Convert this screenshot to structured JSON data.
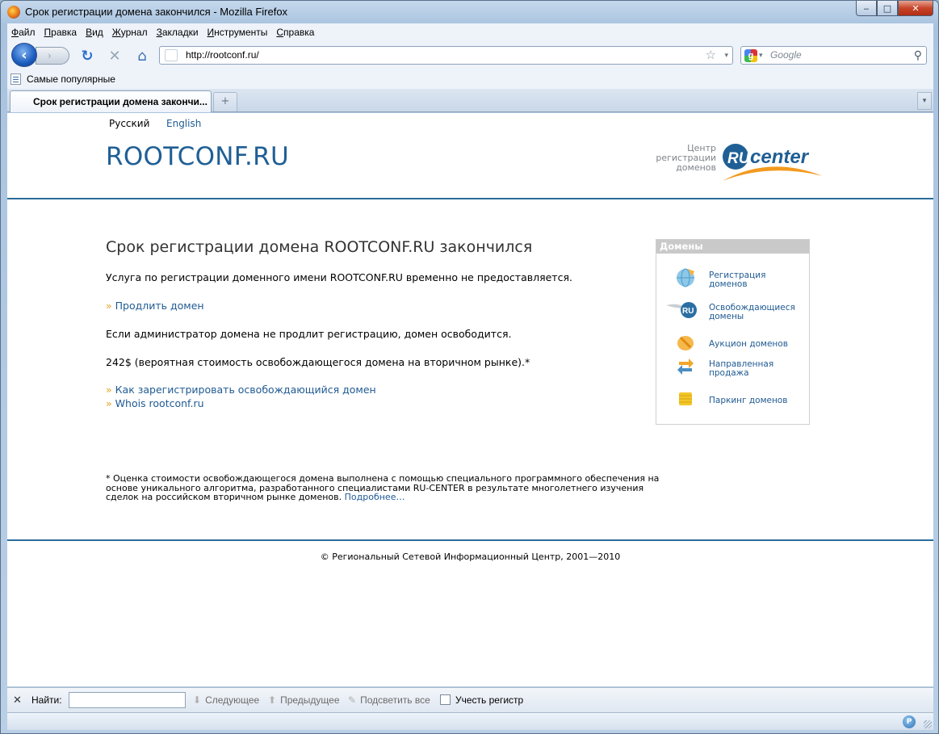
{
  "window": {
    "title": "Срок регистрации домена закончился - Mozilla Firefox",
    "min_label": "‒",
    "max_label": "□",
    "close_label": "✕"
  },
  "menu": [
    "Файл",
    "Правка",
    "Вид",
    "Журнал",
    "Закладки",
    "Инструменты",
    "Справка"
  ],
  "nav": {
    "back_icon": "‹",
    "forward_icon": "›",
    "reload_icon": "↻",
    "stop_icon": "✕",
    "home_icon": "⌂",
    "url": "http://rootconf.ru/",
    "star_icon": "☆",
    "drop_icon": "▾",
    "search_placeholder": "Google",
    "search_engine_letter": "g",
    "search_go_icon": "⚲"
  },
  "bookmarks": {
    "most_visited": "Самые популярные"
  },
  "tabs": {
    "active_title": "Срок регистрации домена закончи...",
    "new_tab_icon": "+",
    "list_icon": "▾"
  },
  "page": {
    "lang_ru": "Русский",
    "lang_en": "English",
    "site_title": "ROOTCONF.RU",
    "rc_caption_lines": [
      "Центр",
      "регистрации",
      "доменов"
    ],
    "rc_logo_ru": "RU",
    "rc_logo_center": "center",
    "heading": "Срок регистрации домена ROOTCONF.RU закончился",
    "service_text": "Услуга по регистрации доменного имени ROOTCONF.RU временно не предоставляется.",
    "renew_link": "Продлить домен",
    "release_text": "Если администратор домена не продлит регистрацию, домен освободится.",
    "price_text": "242$ (вероятная стоимость освобождающегося домена на вторичном рынке).*",
    "how_link": "Как зарегистрировать освобождающийся домен",
    "whois_link": "Whois rootconf.ru",
    "raquo": "»",
    "footnote": "* Оценка стоимости освобождающегося домена выполнена с помощью специального программного обеспечения на основе уникального алгоритма, разработанного специалистами RU-CENTER в результате многолетнего изучения сделок на российском вторичном рынке доменов.",
    "footnote_more": "Подробнее…",
    "copyright": "© Региональный Сетевой Информационный Центр, 2001—2010"
  },
  "sidebar": {
    "title": "Домены",
    "items": [
      {
        "line1": "Регистрация",
        "line2": "доменов",
        "icon": "globe-icon"
      },
      {
        "line1": "Освобождающиеся",
        "line2": "домены",
        "icon": "ru-wing-icon"
      },
      {
        "line1": "Аукцион доменов",
        "line2": "",
        "icon": "gavel-icon"
      },
      {
        "line1": "Направленная",
        "line2": "продажа",
        "icon": "arrows-icon"
      },
      {
        "line1": "Паркинг доменов",
        "line2": "",
        "icon": "coins-icon"
      }
    ],
    "ru_badge": "RU"
  },
  "findbar": {
    "close_icon": "✕",
    "label": "Найти:",
    "next": "Следующее",
    "prev": "Предыдущее",
    "highlight": "Подсветить все",
    "match_case": "Учесть регистр",
    "down_icon": "⬇",
    "up_icon": "⬆",
    "pen_icon": "✎"
  },
  "status": {
    "addon_letter": "P"
  },
  "colors": {
    "link": "#1f5a92",
    "title": "#1f5f95",
    "rule": "#2c6c9a",
    "raquo": "#e4a426",
    "sidebar_head": "#c9c9c9"
  }
}
